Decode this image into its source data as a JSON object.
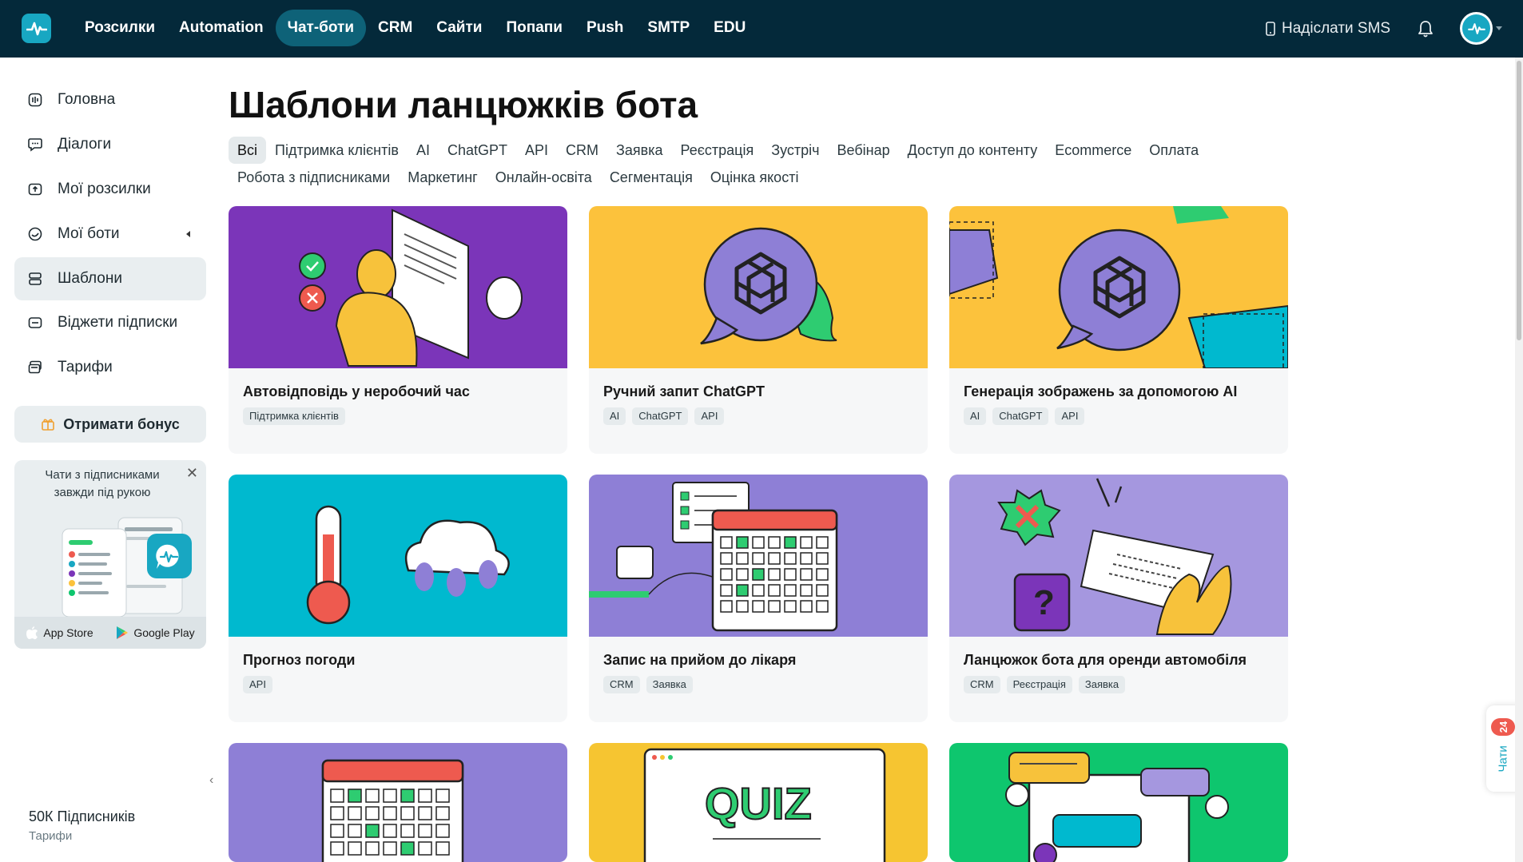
{
  "topbar": {
    "nav": [
      {
        "label": "Розсилки"
      },
      {
        "label": "Automation"
      },
      {
        "label": "Чат-боти",
        "active": true
      },
      {
        "label": "CRM"
      },
      {
        "label": "Сайти"
      },
      {
        "label": "Попапи"
      },
      {
        "label": "Push"
      },
      {
        "label": "SMTP"
      },
      {
        "label": "EDU"
      }
    ],
    "sms_label": "Надіслати SMS",
    "icons": [
      "phone-icon",
      "bell-icon",
      "avatar-icon"
    ]
  },
  "sidebar": {
    "items": [
      {
        "label": "Головна",
        "icon": "home-icon"
      },
      {
        "label": "Діалоги",
        "icon": "dialogs-icon"
      },
      {
        "label": "Мої розсилки",
        "icon": "campaigns-icon"
      },
      {
        "label": "Мої боти",
        "icon": "bots-icon"
      },
      {
        "label": "Шаблони",
        "icon": "templates-icon",
        "active": true
      },
      {
        "label": "Віджети підписки",
        "icon": "widgets-icon"
      },
      {
        "label": "Тарифи",
        "icon": "pricing-icon"
      }
    ],
    "bonus_label": "Отримати бонус",
    "promo_text": "Чати з підписниками завжди під рукою",
    "app_store": "App Store",
    "google_play": "Google Play",
    "subscribers": "50К Підписників",
    "tariffs_link": "Тарифи"
  },
  "main": {
    "title": "Шаблони ланцюжків бота",
    "filters": [
      "Всі",
      "Підтримка клієнтів",
      "AI",
      "ChatGPT",
      "API",
      "CRM",
      "Заявка",
      "Реєстрація",
      "Зустріч",
      "Вебінар",
      "Доступ до контенту",
      "Ecommerce",
      "Оплата",
      "Робота з підписниками",
      "Маркетинг",
      "Онлайн-освіта",
      "Сегментація",
      "Оцінка якості"
    ],
    "active_filter": "Всі",
    "cards": [
      {
        "title": "Автовідповідь у неробочий час",
        "tags": [
          "Підтримка клієнтів"
        ],
        "bg": "#7b35b9"
      },
      {
        "title": "Ручний запит ChatGPT",
        "tags": [
          "AI",
          "ChatGPT",
          "API"
        ],
        "bg": "#fcc23c"
      },
      {
        "title": "Генерація зображень за допомогою AI",
        "tags": [
          "AI",
          "ChatGPT",
          "API"
        ],
        "bg": "#fcc23c"
      },
      {
        "title": "Прогноз погоди",
        "tags": [
          "API"
        ],
        "bg": "#00b9cf"
      },
      {
        "title": "Запис на прийом до лікаря",
        "tags": [
          "CRM",
          "Заявка"
        ],
        "bg": "#8e7fd6"
      },
      {
        "title": "Ланцюжок бота для оренди автомобіля",
        "tags": [
          "CRM",
          "Реєстрація",
          "Заявка"
        ],
        "bg": "#a597df"
      },
      {
        "title": "",
        "tags": [],
        "bg": "#8e7fd6"
      },
      {
        "title": "",
        "tags": [],
        "bg": "#f6c531"
      },
      {
        "title": "",
        "tags": [],
        "bg": "#0ec66e"
      }
    ]
  },
  "chat_widget": {
    "label": "Чати",
    "count": "24"
  },
  "colors": {
    "topbar": "#04293a",
    "accent": "#18a7c2",
    "nav_active": "#0e6278"
  }
}
